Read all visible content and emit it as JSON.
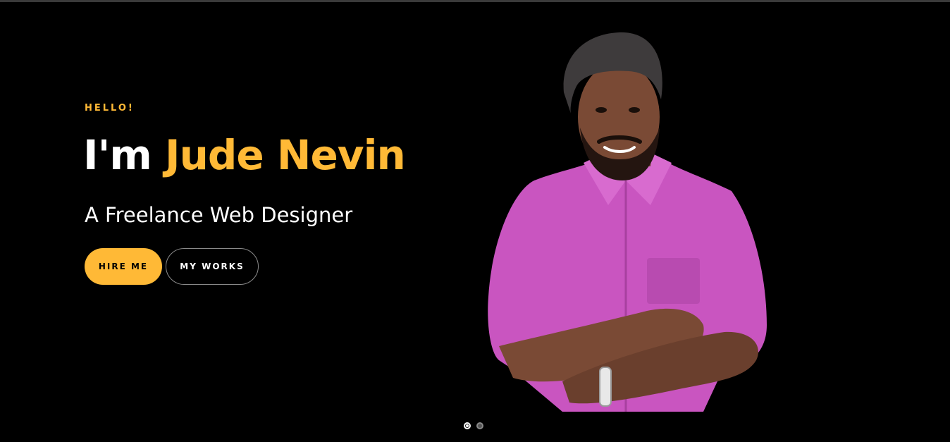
{
  "hero": {
    "greeting": "HELLO!",
    "headline_prefix": "I'm",
    "headline_name": "Jude Nevin",
    "subtitle": "A Freelance Web Designer",
    "buttons": {
      "hire_label": "HIRE ME",
      "works_label": "MY WORKS"
    },
    "portrait_icon": "person-photo",
    "slides": {
      "count": 2,
      "active_index": 0
    }
  },
  "colors": {
    "background": "#000000",
    "accent": "#ffb936",
    "text": "#ffffff",
    "shirt": "#c955c0"
  }
}
